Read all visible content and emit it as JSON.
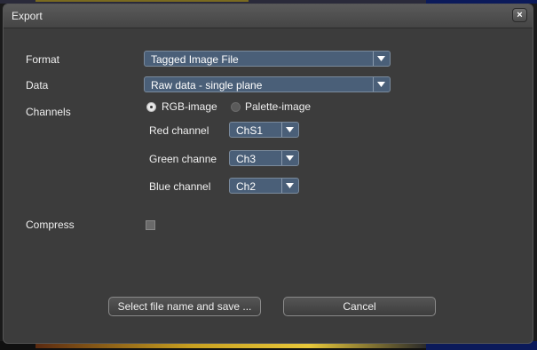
{
  "dialog": {
    "title": "Export",
    "close_symbol": "×"
  },
  "form": {
    "format": {
      "label": "Format",
      "value": "Tagged Image File"
    },
    "data": {
      "label": "Data",
      "value": "Raw data - single plane"
    },
    "channels": {
      "label": "Channels",
      "mode_options": [
        {
          "label": "RGB-image",
          "selected": true
        },
        {
          "label": "Palette-image",
          "selected": false
        }
      ],
      "red": {
        "label": "Red channel",
        "value": "ChS1"
      },
      "green": {
        "label": "Green channe",
        "value": "Ch3"
      },
      "blue": {
        "label": "Blue channel",
        "value": "Ch2"
      }
    },
    "compress": {
      "label": "Compress",
      "checked": false
    }
  },
  "actions": {
    "save_label": "Select file name and save ...",
    "cancel_label": "Cancel"
  },
  "icons": {
    "close": "close-icon",
    "dropdown": "chevron-down-icon"
  },
  "colors": {
    "dialog_bg": "#3c3c3c",
    "combo_bg": "#4a5f78",
    "text": "#f0f0f0"
  }
}
